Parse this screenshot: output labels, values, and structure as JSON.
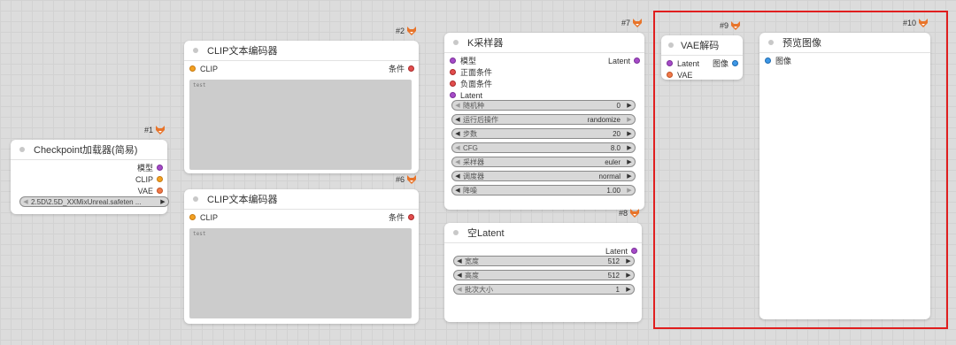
{
  "nodes": {
    "n1": {
      "id": "#1",
      "title": "Checkpoint加载器(简易)",
      "outputs": [
        "模型",
        "CLIP",
        "VAE"
      ],
      "ckpt_value": "2.5D\\2.5D_XXMixUnreal.safeten ..."
    },
    "n2": {
      "id": "#2",
      "title": "CLIP文本编码器",
      "input": "CLIP",
      "output": "条件",
      "text": "test"
    },
    "n6": {
      "id": "#6",
      "title": "CLIP文本编码器",
      "input": "CLIP",
      "output": "条件",
      "text": "test"
    },
    "n7": {
      "id": "#7",
      "title": "K采样器",
      "inputs": [
        "模型",
        "正面条件",
        "负面条件",
        "Latent"
      ],
      "output": "Latent",
      "widgets": [
        {
          "label": "随机种",
          "value": "0"
        },
        {
          "label": "运行后操作",
          "value": "randomize"
        },
        {
          "label": "步数",
          "value": "20"
        },
        {
          "label": "CFG",
          "value": "8.0"
        },
        {
          "label": "采样器",
          "value": "euler"
        },
        {
          "label": "调度器",
          "value": "normal"
        },
        {
          "label": "降噪",
          "value": "1.00"
        }
      ]
    },
    "n8": {
      "id": "#8",
      "title": "空Latent",
      "output": "Latent",
      "widgets": [
        {
          "label": "宽度",
          "value": "512"
        },
        {
          "label": "高度",
          "value": "512"
        },
        {
          "label": "批次大小",
          "value": "1"
        }
      ]
    },
    "n9": {
      "id": "#9",
      "title": "VAE解码",
      "inputs": [
        "Latent",
        "VAE"
      ],
      "output": "图像"
    },
    "n10": {
      "id": "#10",
      "title": "预览图像",
      "input": "图像"
    }
  },
  "colors": {
    "model": "#a64bc8",
    "clip": "#f3a122",
    "conditioning": "#e24d4d",
    "latent": "#a64bc8",
    "vae": "#f0794a",
    "image": "#3d97e6",
    "selection": "#e01e1e"
  },
  "icons": {
    "badge": "fox-icon"
  }
}
